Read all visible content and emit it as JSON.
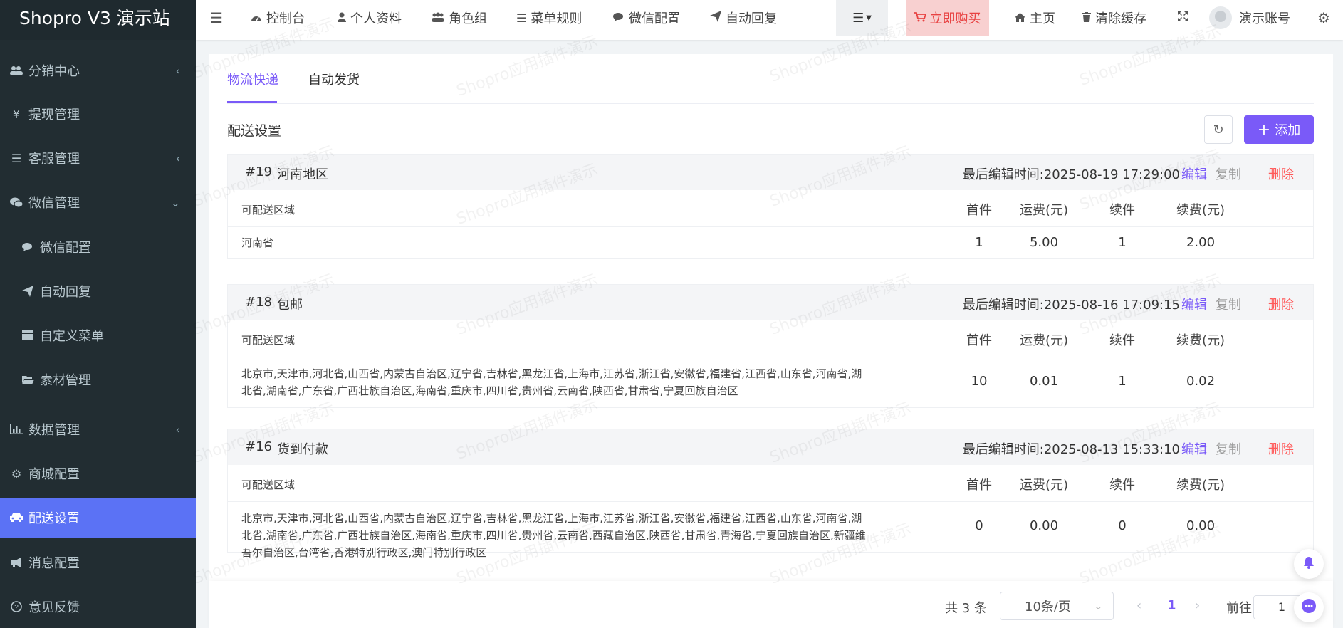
{
  "brand": "Shopro V3 演示站",
  "sidebar": {
    "items": [
      {
        "label": "分销中心",
        "icon": "users-icon"
      },
      {
        "label": "提现管理",
        "icon": "yen-icon"
      },
      {
        "label": "客服管理",
        "icon": "list-icon"
      },
      {
        "label": "微信管理",
        "icon": "wechat-icon"
      },
      {
        "label": "微信配置",
        "icon": "comments-icon"
      },
      {
        "label": "自动回复",
        "icon": "paper-plane-icon"
      },
      {
        "label": "自定义菜单",
        "icon": "server-icon"
      },
      {
        "label": "素材管理",
        "icon": "folder-open-icon"
      },
      {
        "label": "数据管理",
        "icon": "bar-chart-icon"
      },
      {
        "label": "商城配置",
        "icon": "cogs-icon"
      },
      {
        "label": "配送设置",
        "icon": "car-icon"
      },
      {
        "label": "消息配置",
        "icon": "bullhorn-icon"
      },
      {
        "label": "意见反馈",
        "icon": "question-circle-icon"
      }
    ]
  },
  "topnav": {
    "items": [
      {
        "label": "控制台",
        "icon": "dashboard-icon"
      },
      {
        "label": "个人资料",
        "icon": "user-icon"
      },
      {
        "label": "角色组",
        "icon": "group-icon"
      },
      {
        "label": "菜单规则",
        "icon": "bars-icon"
      },
      {
        "label": "微信配置",
        "icon": "comments-icon"
      },
      {
        "label": "自动回复",
        "icon": "paper-plane-icon"
      }
    ],
    "buy": "立即购买",
    "home": "主页",
    "clear_cache": "清除缓存",
    "account": "演示账号"
  },
  "tabs": [
    "物流快递",
    "自动发货"
  ],
  "section_title": "配送设置",
  "add_label": "添加",
  "columns": {
    "area": "可配送区域",
    "first": "首件",
    "fee": "运费(元)",
    "additional": "续件",
    "additional_fee": "续费(元)"
  },
  "templates": [
    {
      "id": "#19",
      "name": "河南地区",
      "time": "最后编辑时间:2025-08-19 17:29:00",
      "edit": "编辑",
      "copy": "复制",
      "delete": "删除",
      "row": {
        "area": "河南省",
        "first": "1",
        "fee": "5.00",
        "additional": "1",
        "additional_fee": "2.00"
      }
    },
    {
      "id": "#18",
      "name": "包邮",
      "time": "最后编辑时间:2025-08-16 17:09:15",
      "edit": "编辑",
      "copy": "复制",
      "delete": "删除",
      "row": {
        "area": "北京市,天津市,河北省,山西省,内蒙古自治区,辽宁省,吉林省,黑龙江省,上海市,江苏省,浙江省,安徽省,福建省,江西省,山东省,河南省,湖北省,湖南省,广东省,广西壮族自治区,海南省,重庆市,四川省,贵州省,云南省,陕西省,甘肃省,宁夏回族自治区",
        "first": "10",
        "fee": "0.01",
        "additional": "1",
        "additional_fee": "0.02"
      }
    },
    {
      "id": "#16",
      "name": "货到付款",
      "time": "最后编辑时间:2025-08-13 15:33:10",
      "edit": "编辑",
      "copy": "复制",
      "delete": "删除",
      "row": {
        "area": "北京市,天津市,河北省,山西省,内蒙古自治区,辽宁省,吉林省,黑龙江省,上海市,江苏省,浙江省,安徽省,福建省,江西省,山东省,河南省,湖北省,湖南省,广东省,广西壮族自治区,海南省,重庆市,四川省,贵州省,云南省,西藏自治区,陕西省,甘肃省,青海省,宁夏回族自治区,新疆维吾尔自治区,台湾省,香港特别行政区,澳门特别行政区",
        "first": "0",
        "fee": "0.00",
        "additional": "0",
        "additional_fee": "0.00"
      }
    }
  ],
  "pager": {
    "total": "共 3 条",
    "page_size": "10条/页",
    "current_page": "1",
    "goto": "前往",
    "goto_value": "1"
  },
  "watermark": "Shopro应用插件演示",
  "colors": {
    "sidebar_bg": "#222d32",
    "active": "#5b72f5",
    "accent": "#7a5af8",
    "danger": "#ff5a5a"
  }
}
